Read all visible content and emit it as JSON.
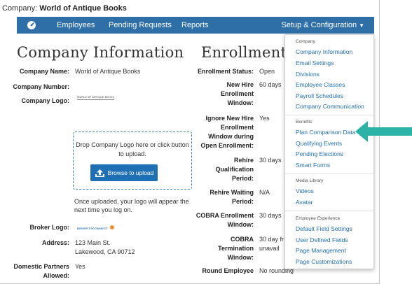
{
  "company_bar": {
    "prefix": "Company:",
    "name": "World of Antique Books"
  },
  "navbar": {
    "items": [
      "Employees",
      "Pending Requests",
      "Reports"
    ],
    "dropdown": "Setup & Configuration",
    "accent": "#2e6fa8"
  },
  "company_info": {
    "title": "Company Information",
    "rows": [
      {
        "label": "Company Name:",
        "value": "World of Antique Books"
      },
      {
        "label": "Company Number:",
        "value": ""
      },
      {
        "label": "Company Logo:",
        "value": "WORLD OF ANTIQUE BOOKS"
      }
    ],
    "upload": {
      "text": "Drop Company Logo here or click button to upload.",
      "button": "Browse to upload",
      "after": "Once uploaded, your logo will appear the next time you log on."
    },
    "broker_logo_label": "Broker Logo:",
    "broker_logo_text": "BENEFITSCONNECT",
    "address_label": "Address:",
    "address_line1": "123 Main St.",
    "address_line2": "Lakewood, CA 90712",
    "domestic_label_1": "Domestic Partners",
    "domestic_label_2": "Allowed:",
    "domestic_value": "Yes"
  },
  "enrollment": {
    "title": "Enrollment",
    "status_label": "Enrollment Status:",
    "status_value": "Open",
    "new_hire_l1": "New Hire",
    "new_hire_l2": "Enrollment",
    "new_hire_l3": "Window:",
    "new_hire_value": "60 days",
    "ignore_l1": "Ignore New Hire",
    "ignore_l2": "Enrollment",
    "ignore_l3": "Window during",
    "ignore_l4": "Open Enrollment:",
    "ignore_value": "Yes",
    "rehire_l1": "Rehire",
    "rehire_l2": "Qualification",
    "rehire_l3": "Period:",
    "rehire_value": "30 days",
    "rehire_wait_l1": "Rehire Waiting",
    "rehire_wait_l2": "Period:",
    "rehire_wait_value": "N/A",
    "cobra_enr_l1": "COBRA Enrollment",
    "cobra_enr_l2": "Window:",
    "cobra_enr_value": "30 days",
    "cobra_term_l1": "COBRA",
    "cobra_term_l2": "Termination",
    "cobra_term_l3": "Window:",
    "cobra_term_value_1": "30 day fr",
    "cobra_term_value_2": "unavail",
    "round_label": "Round Employee",
    "round_value": "No rounding"
  },
  "menu": {
    "company_header": "Company",
    "company_items": [
      "Company Information",
      "Email Settings",
      "Divisions",
      "Employee Classes",
      "Payroll Schedules",
      "Company Communication"
    ],
    "benefits_header": "Benefits",
    "benefits_items": [
      "Plan Comparison Data",
      "Qualifying Events",
      "Pending Elections",
      "Smart Forms"
    ],
    "media_header": "Media Library",
    "media_items": [
      "Videos",
      "Avatar"
    ],
    "experience_header": "Employee Experience",
    "experience_items": [
      "Default Field Settings",
      "User Defined Fields",
      "Page Management",
      "Page Customizations"
    ]
  },
  "arrow_color": "#2bb3a8"
}
